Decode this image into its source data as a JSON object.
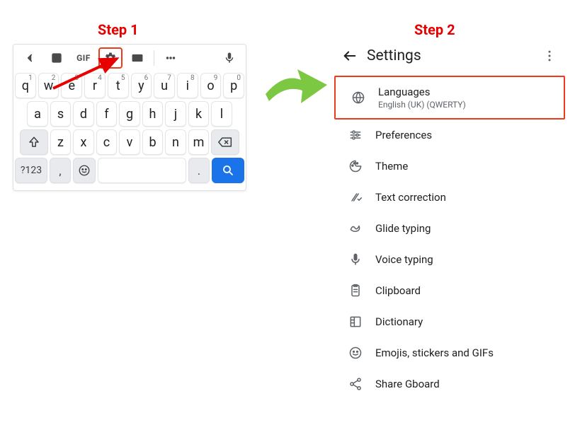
{
  "steps": {
    "s1": "Step 1",
    "s2": "Step 2"
  },
  "toolbar": {
    "gif": "GIF"
  },
  "kb": {
    "row1": [
      {
        "k": "q",
        "s": "1"
      },
      {
        "k": "w",
        "s": "2"
      },
      {
        "k": "e",
        "s": "3"
      },
      {
        "k": "r",
        "s": "4"
      },
      {
        "k": "t",
        "s": "5"
      },
      {
        "k": "y",
        "s": "6"
      },
      {
        "k": "u",
        "s": "7"
      },
      {
        "k": "i",
        "s": "8"
      },
      {
        "k": "o",
        "s": "9"
      },
      {
        "k": "p",
        "s": "0"
      }
    ],
    "row2": [
      "a",
      "s",
      "d",
      "f",
      "g",
      "h",
      "j",
      "k",
      "l"
    ],
    "row3": [
      "z",
      "x",
      "c",
      "v",
      "b",
      "n",
      "m"
    ],
    "sym": "?123",
    "comma": ",",
    "period": "."
  },
  "settings": {
    "title": "Settings",
    "items": [
      {
        "title": "Languages",
        "sub": "English (UK) (QWERTY)"
      },
      {
        "title": "Preferences"
      },
      {
        "title": "Theme"
      },
      {
        "title": "Text correction"
      },
      {
        "title": "Glide typing"
      },
      {
        "title": "Voice typing"
      },
      {
        "title": "Clipboard"
      },
      {
        "title": "Dictionary"
      },
      {
        "title": "Emojis, stickers and GIFs"
      },
      {
        "title": "Share Gboard"
      }
    ]
  }
}
